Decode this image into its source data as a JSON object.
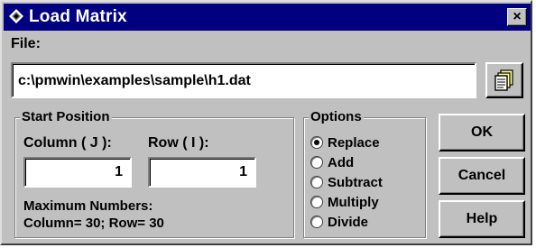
{
  "window": {
    "title": "Load Matrix",
    "close_label": "×"
  },
  "file": {
    "label": "File:",
    "path": "c:\\pmwin\\examples\\sample\\h1.dat",
    "browse_icon": "document-stack-icon"
  },
  "start_position": {
    "title": "Start Position",
    "column_label": "Column  ( J ):",
    "row_label": "Row ( I ):",
    "column_value": "1",
    "row_value": "1",
    "max_title": "Maximum Numbers:",
    "max_values": "Column= 30; Row= 30"
  },
  "options": {
    "title": "Options",
    "items": [
      {
        "label": "Replace",
        "checked": true
      },
      {
        "label": "Add",
        "checked": false
      },
      {
        "label": "Subtract",
        "checked": false
      },
      {
        "label": "Multiply",
        "checked": false
      },
      {
        "label": "Divide",
        "checked": false
      }
    ]
  },
  "buttons": {
    "ok": "OK",
    "cancel": "Cancel",
    "help": "Help"
  },
  "colors": {
    "titlebar": "#000080",
    "face": "#c0c0c0"
  }
}
